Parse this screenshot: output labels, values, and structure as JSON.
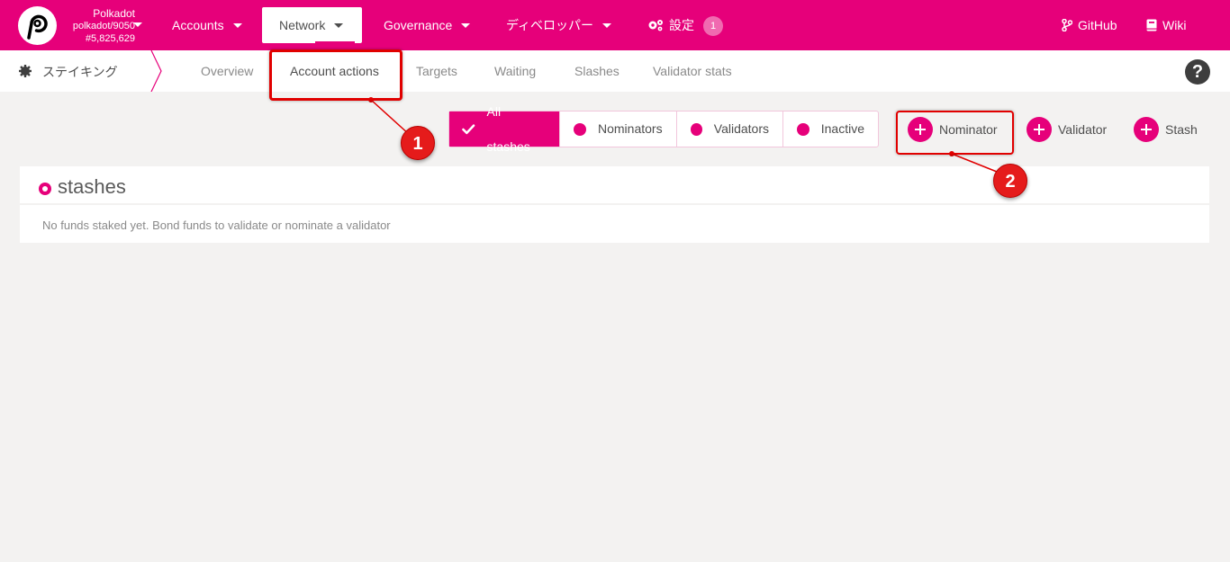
{
  "topbar": {
    "chain_name": "Polkadot",
    "chain_version": "polkadot/9050",
    "block_number": "#5,825,629",
    "menus": [
      {
        "label": "Accounts"
      },
      {
        "label": "Network"
      },
      {
        "label": "Governance"
      },
      {
        "label": "ディベロッパー"
      }
    ],
    "settings_label": "設定",
    "settings_badge": "1",
    "github_label": "GitHub",
    "wiki_label": "Wiki"
  },
  "subbar": {
    "section_label": "ステイキング",
    "tabs": [
      {
        "label": "Overview"
      },
      {
        "label": "Account actions"
      },
      {
        "label": "Targets"
      },
      {
        "label": "Waiting"
      },
      {
        "label": "Slashes"
      },
      {
        "label": "Validator stats"
      }
    ],
    "help_label": "?"
  },
  "filters": [
    {
      "label": "All stashes"
    },
    {
      "label": "Nominators"
    },
    {
      "label": "Validators"
    },
    {
      "label": "Inactive"
    }
  ],
  "actions": [
    {
      "label": "Nominator"
    },
    {
      "label": "Validator"
    },
    {
      "label": "Stash"
    }
  ],
  "stashes": {
    "title": "stashes",
    "empty_text": "No funds staked yet. Bond funds to validate or nominate a validator"
  },
  "annotations": [
    "1",
    "2"
  ],
  "colors": {
    "brand": "#e6007a",
    "annotation": "#e10000"
  }
}
